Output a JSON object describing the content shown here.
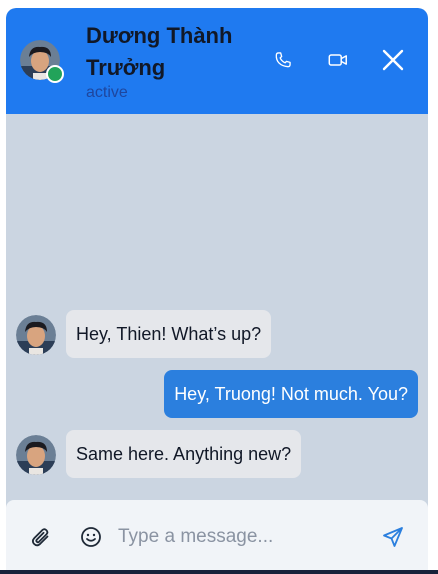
{
  "header": {
    "contact_name": "Dương Thành Trưởng",
    "status": "active",
    "online": true,
    "accent_color": "#1f7af0"
  },
  "icons": {
    "call": "phone-icon",
    "video": "video-camera-icon",
    "close": "close-icon",
    "attach": "paperclip-icon",
    "emoji": "smiley-icon",
    "send": "send-icon"
  },
  "messages": [
    {
      "direction": "incoming",
      "text": "Hey, Thien! What’s up?"
    },
    {
      "direction": "outgoing",
      "text": "Hey, Truong! Not much. You?"
    },
    {
      "direction": "incoming",
      "text": "Same here. Anything new?"
    }
  ],
  "composer": {
    "placeholder": "Type a message...",
    "value": ""
  }
}
